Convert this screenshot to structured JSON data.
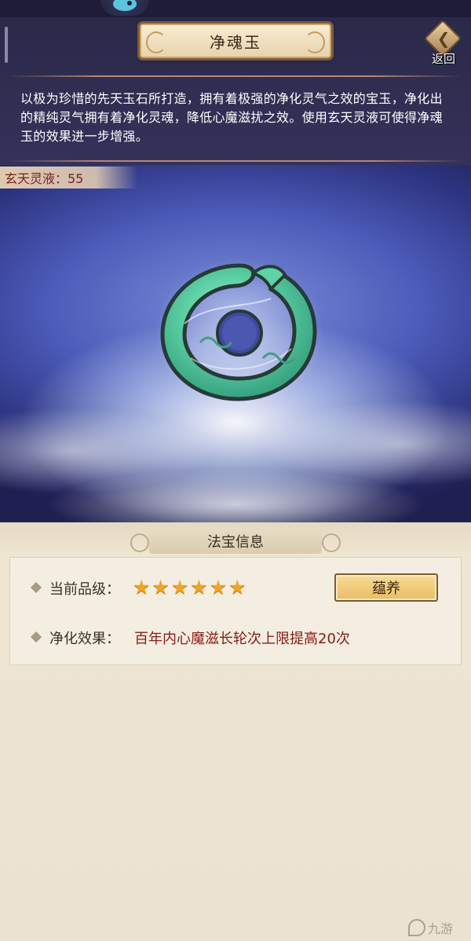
{
  "header": {
    "title": "净魂玉",
    "back_label": "返回"
  },
  "description": "以极为珍惜的先天玉石所打造，拥有着极强的净化灵气之效的宝玉，净化出的精纯灵气拥有着净化灵魂，降低心魔滋扰之效。使用玄天灵液可使得净魂玉的效果进一步增强。",
  "resource": {
    "label": "玄天灵液：55"
  },
  "panel": {
    "header": "法宝信息",
    "grade_label": "当前品级：",
    "grade_stars": 6,
    "cultivate_button": "蕴养",
    "effect_label": "净化效果：",
    "effect_value": "百年内心魔滋长轮次上限提高20次"
  },
  "watermark": "九游",
  "colors": {
    "effect_value": "#8c1a14",
    "resource_text": "#7a1e1e",
    "star": "#f1a51f",
    "jade": "#5fd2a6"
  },
  "icons": [
    "back-arrow-icon",
    "diamond-bullet-icon",
    "star-icon",
    "jade-ring-icon",
    "mascot-icon"
  ]
}
